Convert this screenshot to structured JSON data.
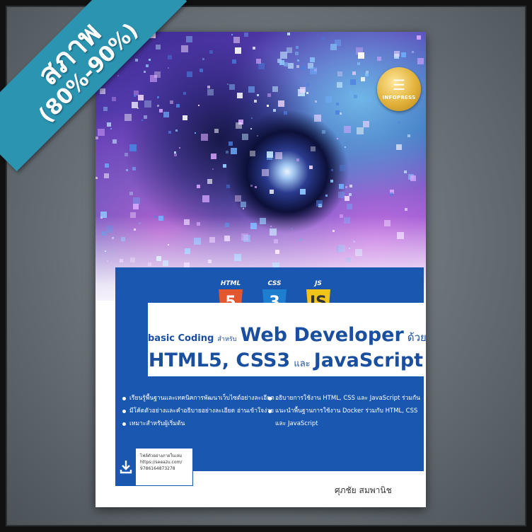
{
  "ribbon": {
    "line1": "สภาพ",
    "line2": "(80%-90%)"
  },
  "publisher": {
    "name": "INFOPRESS"
  },
  "tech_logos": [
    "HTML",
    "CSS",
    "JS"
  ],
  "title": {
    "line1_a": "basic Coding",
    "line1_b": "สำหรับ",
    "line1_c": "Web Developer",
    "line1_d": "ด้วย",
    "line2_a": "HTML5, CSS3",
    "line2_b": "และ",
    "line2_c": "JavaScript"
  },
  "bullets_left": [
    "เรียนรู้พื้นฐานและเทคนิคการพัฒนาเว็บไซต์อย่างละเอียด",
    "มีโค้ดตัวอย่างและคำอธิบายอย่างละเอียด อ่านเข้าใจง่าย",
    "เหมาะสำหรับผู้เริ่มต้น"
  ],
  "bullets_right": [
    "อธิบายการใช้งาน HTML, CSS และ JavaScript ร่วมกัน",
    "แนะนำพื้นฐานการใช้งาน Docker ร่วมกับ HTML, CSS"
  ],
  "bullets_right_cont": "และ JavaScript",
  "download": {
    "line1": "ไฟล์ตัวอย่างภายในเล่ม",
    "line2": "https://seeazu.com/",
    "line3": "9786164873278"
  },
  "author": "ศุภชัย สมพานิช"
}
